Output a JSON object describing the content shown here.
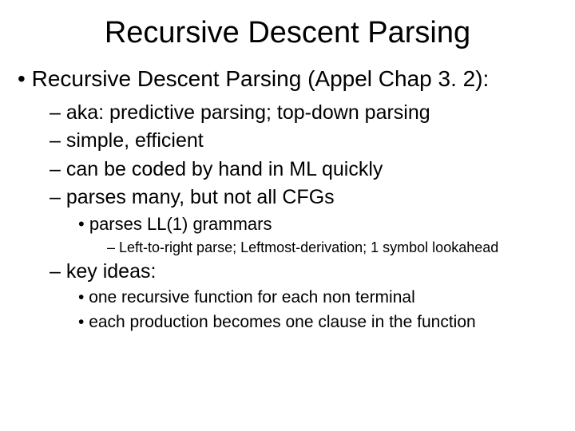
{
  "title": "Recursive Descent Parsing",
  "b1": "Recursive Descent Parsing (Appel Chap 3. 2):",
  "s1": "aka: predictive parsing; top-down parsing",
  "s2": "simple, efficient",
  "s3": "can be coded by hand in ML quickly",
  "s4": "parses many, but not all CFGs",
  "s4a": "parses LL(1) grammars",
  "s4a1": "Left-to-right parse; Leftmost-derivation; 1 symbol lookahead",
  "s5": "key ideas:",
  "s5a": "one recursive function for each non terminal",
  "s5b": "each production becomes one clause in the function"
}
